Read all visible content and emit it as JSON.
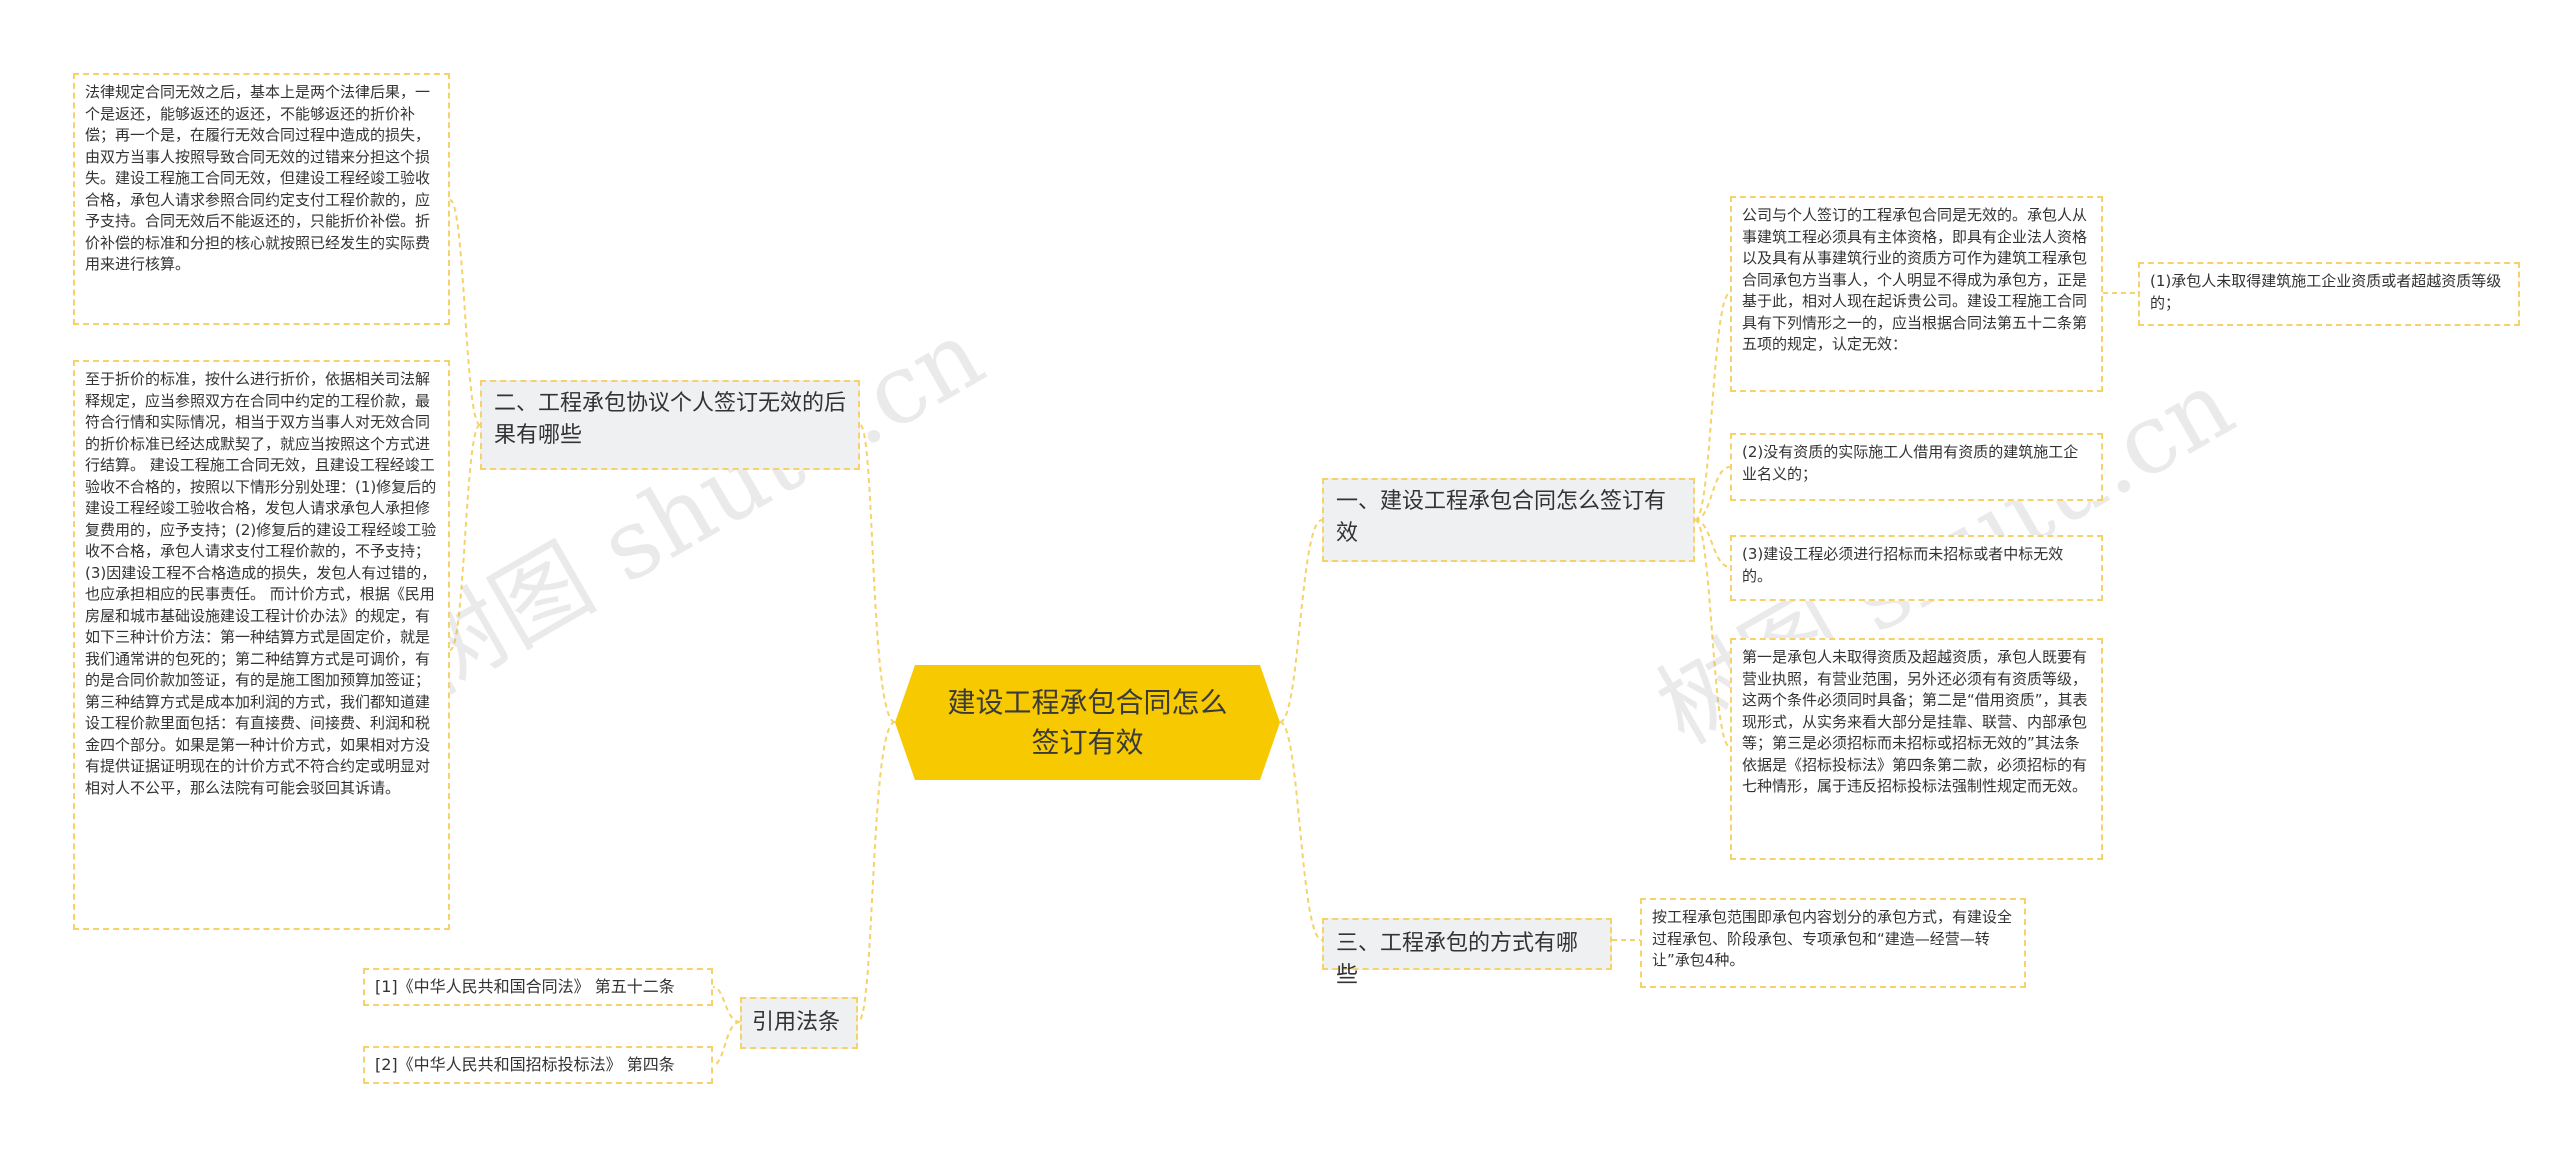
{
  "root": {
    "title": "建设工程承包合同怎么签订有效"
  },
  "branches": {
    "left_consequence": "二、工程承包协议个人签订无效的后果有哪些",
    "left_laws": "引用法条",
    "right_how": "一、建设工程承包合同怎么签订有效",
    "right_methods": "三、工程承包的方式有哪些"
  },
  "leaves": {
    "consequence_1": "法律规定合同无效之后，基本上是两个法律后果，一个是返还，能够返还的返还，不能够返还的折价补偿；再一个是，在履行无效合同过程中造成的损失，由双方当事人按照导致合同无效的过错来分担这个损失。建设工程施工合同无效，但建设工程经竣工验收合格，承包人请求参照合同约定支付工程价款的，应予支持。合同无效后不能返还的，只能折价补偿。折价补偿的标准和分担的核心就按照已经发生的实际费用来进行核算。",
    "consequence_2": "至于折价的标准，按什么进行折价，依据相关司法解释规定，应当参照双方在合同中约定的工程价款，最符合行情和实际情况，相当于双方当事人对无效合同的折价标准已经达成默契了，就应当按照这个方式进行结算。 建设工程施工合同无效，且建设工程经竣工验收不合格的，按照以下情形分别处理：(1)修复后的建设工程经竣工验收合格，发包人请求承包人承担修复费用的，应予支持；(2)修复后的建设工程经竣工验收不合格，承包人请求支付工程价款的，不予支持；(3)因建设工程不合格造成的损失，发包人有过错的，也应承担相应的民事责任。 而计价方式，根据《民用房屋和城市基础设施建设工程计价办法》的规定，有如下三种计价方法：第一种结算方式是固定价，就是我们通常讲的包死的；第二种结算方式是可调价，有的是合同价款加签证，有的是施工图加预算加签证；第三种结算方式是成本加利润的方式，我们都知道建设工程价款里面包括：有直接费、间接费、利润和税金四个部分。如果是第一种计价方式，如果相对方没有提供证据证明现在的计价方式不符合约定或明显对相对人不公平，那么法院有可能会驳回其诉请。",
    "law_1": "[1]《中华人民共和国合同法》 第五十二条",
    "law_2": "[2]《中华人民共和国招标投标法》 第四条",
    "how_1": "公司与个人签订的工程承包合同是无效的。承包人从事建筑工程必须具有主体资格，即具有企业法人资格以及具有从事建筑行业的资质方可作为建筑工程承包合同承包方当事人，个人明显不得成为承包方，正是基于此，相对人现在起诉贵公司。建设工程施工合同具有下列情形之一的，应当根据合同法第五十二条第五项的规定，认定无效：",
    "how_1_sub": "(1)承包人未取得建筑施工企业资质或者超越资质等级的；",
    "how_2": "(2)没有资质的实际施工人借用有资质的建筑施工企业名义的；",
    "how_3": "(3)建设工程必须进行招标而未招标或者中标无效的。",
    "how_4": "第一是承包人未取得资质及超越资质，承包人既要有营业执照，有营业范围，另外还必须有有资质等级，这两个条件必须同时具备；第二是“借用资质”，其表现形式，从实务来看大部分是挂靠、联营、内部承包等；第三是必须招标而未招标或招标无效的”其法条依据是《招标投标法》第四条第二款，必须招标的有七种情形，属于违反招标投标法强制性规定而无效。",
    "methods_1": "按工程承包范围即承包内容划分的承包方式，有建设全过程承包、阶段承包、专项承包和“建造—经营—转让”承包4种。"
  },
  "watermarks": [
    "树图 shutu.cn",
    "树图 shutu.cn"
  ],
  "colors": {
    "root_fill": "#f7c900",
    "connector": "#f5d36a",
    "branch_fill": "#eef0f2"
  }
}
